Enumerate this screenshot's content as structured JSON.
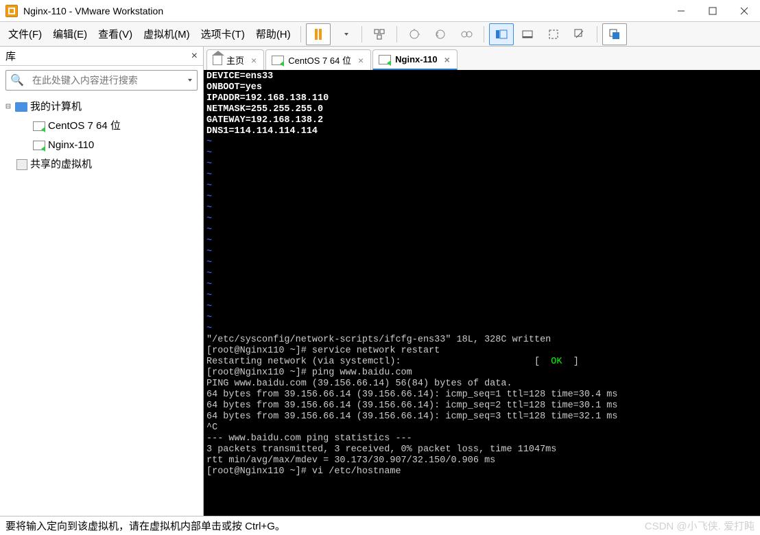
{
  "window": {
    "title": "Nginx-110 - VMware Workstation"
  },
  "menu": {
    "file": "文件(F)",
    "edit": "编辑(E)",
    "view": "查看(V)",
    "vm": "虚拟机(M)",
    "tabs": "选项卡(T)",
    "help": "帮助(H)"
  },
  "sidebar": {
    "title": "库",
    "search_placeholder": "在此处键入内容进行搜索",
    "my_computer": "我的计算机",
    "vm_centos": "CentOS 7 64 位",
    "vm_nginx": "Nginx-110",
    "shared": "共享的虚拟机"
  },
  "tabs": {
    "home": "主页",
    "centos": "CentOS 7 64 位",
    "nginx": "Nginx-110"
  },
  "terminal": {
    "config": "DEVICE=ens33\nONBOOT=yes\nIPADDR=192.168.138.110\nNETMASK=255.255.255.0\nGATEWAY=192.168.138.2\nDNS1=114.114.114.114",
    "tilde": "~",
    "written": "\"/etc/sysconfig/network-scripts/ifcfg-ens33\" 18L, 328C written",
    "prompt1": "[root@Nginx110 ~]# service network restart",
    "restart_line": "Restarting network (via systemctl):                        [  ",
    "ok": "OK",
    "restart_end": "  ]",
    "prompt2": "[root@Nginx110 ~]# ping www.baidu.com",
    "ping_header": "PING www.baidu.com (39.156.66.14) 56(84) bytes of data.",
    "ping1": "64 bytes from 39.156.66.14 (39.156.66.14): icmp_seq=1 ttl=128 time=30.4 ms",
    "ping2": "64 bytes from 39.156.66.14 (39.156.66.14): icmp_seq=2 ttl=128 time=30.1 ms",
    "ping3": "64 bytes from 39.156.66.14 (39.156.66.14): icmp_seq=3 ttl=128 time=32.1 ms",
    "ctrlc": "^C",
    "stats_hdr": "--- www.baidu.com ping statistics ---",
    "stats1": "3 packets transmitted, 3 received, 0% packet loss, time 11047ms",
    "stats2": "rtt min/avg/max/mdev = 30.173/30.907/32.150/0.906 ms",
    "prompt3": "[root@Nginx110 ~]# vi /etc/hostname"
  },
  "statusbar": {
    "hint": "要将输入定向到该虚拟机，请在虚拟机内部单击或按 Ctrl+G。",
    "watermark": "CSDN @小飞侠. 爱打盹"
  }
}
